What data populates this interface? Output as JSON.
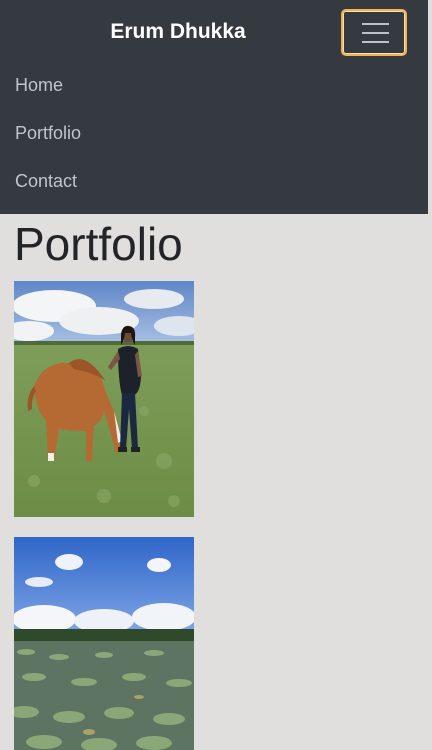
{
  "navbar": {
    "brand": "Erum Dhukka",
    "items": [
      {
        "label": "Home"
      },
      {
        "label": "Portfolio"
      },
      {
        "label": "Contact"
      }
    ],
    "toggler_icon": "hamburger-menu-icon",
    "background_color": "#343a40",
    "toggler_focus_color": "#f0b552"
  },
  "main": {
    "title": "Portfolio",
    "photos": [
      {
        "subject": "woman standing with a chestnut horse grazing in a grassy field"
      },
      {
        "subject": "pond covered with lily pads under a blue sky with clouds"
      }
    ]
  },
  "colors": {
    "page_background": "#e1dfde",
    "nav_text": "#c2c5c8",
    "brand_text": "#ffffff",
    "title_text": "#222428"
  }
}
